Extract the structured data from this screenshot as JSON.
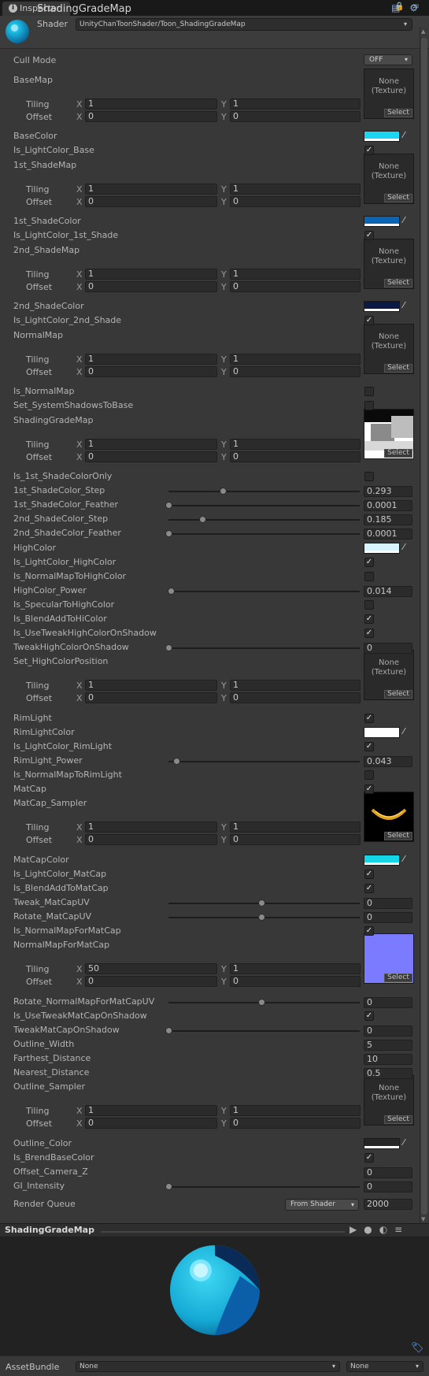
{
  "window": {
    "tab_title": "Inspector"
  },
  "header": {
    "material_name": "ShadingGradeMap",
    "shader_label": "Shader",
    "shader_value": "UnityChanToonShader/Toon_ShadingGradeMap"
  },
  "cull": {
    "label": "Cull Mode",
    "value": "OFF"
  },
  "common": {
    "tiling": "Tiling",
    "offset": "Offset",
    "x": "X",
    "y": "Y",
    "none": "None",
    "texture": "(Texture)",
    "select": "Select"
  },
  "maps": [
    {
      "label": "BaseMap",
      "tx": "1",
      "ty": "1",
      "ox": "0",
      "oy": "0"
    },
    {
      "label": "1st_ShadeMap",
      "tx": "1",
      "ty": "1",
      "ox": "0",
      "oy": "0"
    },
    {
      "label": "2nd_ShadeMap",
      "tx": "1",
      "ty": "1",
      "ox": "0",
      "oy": "0"
    },
    {
      "label": "NormalMap",
      "tx": "1",
      "ty": "1",
      "ox": "0",
      "oy": "0"
    },
    {
      "label": "ShadingGradeMap",
      "tx": "1",
      "ty": "1",
      "ox": "0",
      "oy": "0"
    },
    {
      "label": "Set_HighColorPosition",
      "tx": "1",
      "ty": "1",
      "ox": "0",
      "oy": "0"
    },
    {
      "label": "MatCap_Sampler",
      "tx": "1",
      "ty": "1",
      "ox": "0",
      "oy": "0"
    },
    {
      "label": "NormalMapForMatCap",
      "tx": "50",
      "ty": "1",
      "ox": "0",
      "oy": "0"
    },
    {
      "label": "Outline_Sampler",
      "tx": "1",
      "ty": "1",
      "ox": "0",
      "oy": "0"
    }
  ],
  "colors": [
    {
      "label": "BaseColor",
      "hex": "#1ad6f0"
    },
    {
      "label": "1st_ShadeColor",
      "hex": "#0b64b4"
    },
    {
      "label": "2nd_ShadeColor",
      "hex": "#0a1a44"
    },
    {
      "label": "HighColor",
      "hex": "#d6f4ff"
    },
    {
      "label": "RimLightColor",
      "hex": "#ffffff"
    },
    {
      "label": "MatCapColor",
      "hex": "#14d6e6"
    },
    {
      "label": "Outline_Color",
      "hex": "#262626"
    }
  ],
  "toggles": [
    {
      "label": "Is_LightColor_Base",
      "on": true
    },
    {
      "label": "Is_LightColor_1st_Shade",
      "on": true
    },
    {
      "label": "Is_LightColor_2nd_Shade",
      "on": true
    },
    {
      "label": "Is_NormalMap",
      "on": false
    },
    {
      "label": "Set_SystemShadowsToBase",
      "on": false
    },
    {
      "label": "Is_1st_ShadeColorOnly",
      "on": false
    },
    {
      "label": "Is_LightColor_HighColor",
      "on": true
    },
    {
      "label": "Is_NormalMapToHighColor",
      "on": false
    },
    {
      "label": "Is_SpecularToHighColor",
      "on": false
    },
    {
      "label": "Is_BlendAddToHiColor",
      "on": true
    },
    {
      "label": "Is_UseTweakHighColorOnShadow",
      "on": true
    },
    {
      "label": "RimLight",
      "on": true
    },
    {
      "label": "Is_LightColor_RimLight",
      "on": true
    },
    {
      "label": "Is_NormalMapToRimLight",
      "on": false
    },
    {
      "label": "MatCap",
      "on": true
    },
    {
      "label": "Is_LightColor_MatCap",
      "on": true
    },
    {
      "label": "Is_BlendAddToMatCap",
      "on": true
    },
    {
      "label": "Is_NormalMapForMatCap",
      "on": true
    },
    {
      "label": "Is_UseTweakMatCapOnShadow",
      "on": true
    },
    {
      "label": "Is_BrendBaseColor",
      "on": true
    }
  ],
  "sliders": [
    {
      "label": "1st_ShadeColor_Step",
      "value": "0.293",
      "level": 0.293
    },
    {
      "label": "1st_ShadeColor_Feather",
      "value": "0.0001",
      "level": 0.0001
    },
    {
      "label": "2nd_ShadeColor_Step",
      "value": "0.185",
      "level": 0.185
    },
    {
      "label": "2nd_ShadeColor_Feather",
      "value": "0.0001",
      "level": 0.0001
    },
    {
      "label": "HighColor_Power",
      "value": "0.014",
      "level": 0.014
    },
    {
      "label": "TweakHighColorOnShadow",
      "value": "0",
      "level": 0
    },
    {
      "label": "RimLight_Power",
      "value": "0.043",
      "level": 0.043
    },
    {
      "label": "Tweak_MatCapUV",
      "value": "0",
      "level": 0.5
    },
    {
      "label": "Rotate_MatCapUV",
      "value": "0",
      "level": 0.5
    },
    {
      "label": "Rotate_NormalMapForMatCapUV",
      "value": "0",
      "level": 0.5
    },
    {
      "label": "TweakMatCapOnShadow",
      "value": "0",
      "level": 0
    },
    {
      "label": "GI_Intensity",
      "value": "0",
      "level": 0
    }
  ],
  "floats": [
    {
      "label": "Outline_Width",
      "value": "5"
    },
    {
      "label": "Farthest_Distance",
      "value": "10"
    },
    {
      "label": "Nearest_Distance",
      "value": "0.5"
    },
    {
      "label": "Offset_Camera_Z",
      "value": "0"
    }
  ],
  "render_queue": {
    "label": "Render Queue",
    "mode": "From Shader",
    "value": "2000"
  },
  "preview": {
    "title": "ShadingGradeMap"
  },
  "assetbundle": {
    "label": "AssetBundle",
    "name": "None",
    "variant": "None"
  }
}
